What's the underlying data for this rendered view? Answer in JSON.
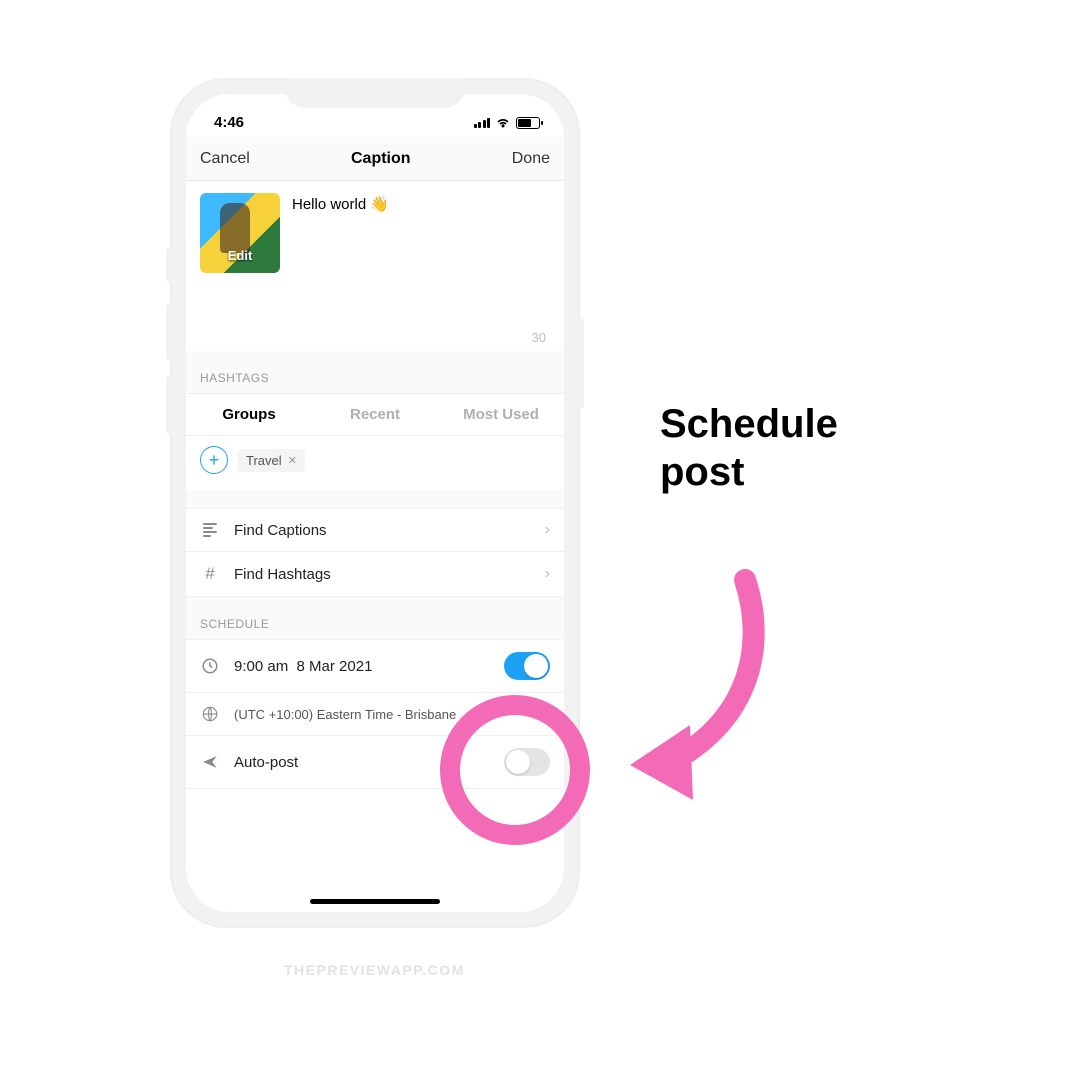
{
  "status": {
    "time": "4:46"
  },
  "navbar": {
    "cancel": "Cancel",
    "title": "Caption",
    "done": "Done"
  },
  "caption": {
    "text": "Hello world 👋",
    "edit_label": "Edit",
    "counter": "30"
  },
  "hashtags": {
    "section_title": "HASHTAGS",
    "tabs": [
      "Groups",
      "Recent",
      "Most Used"
    ],
    "tag": "Travel"
  },
  "rows": {
    "find_captions": "Find Captions",
    "find_hashtags": "Find Hashtags"
  },
  "schedule": {
    "section_title": "SCHEDULE",
    "time": "9:00 am",
    "date": "8 Mar 2021",
    "timezone": "(UTC +10:00) Eastern Time - Brisbane",
    "autopost": "Auto-post"
  },
  "annotation": {
    "line1": "Schedule",
    "line2": "post"
  },
  "watermark": "THEPREVIEWAPP.COM"
}
